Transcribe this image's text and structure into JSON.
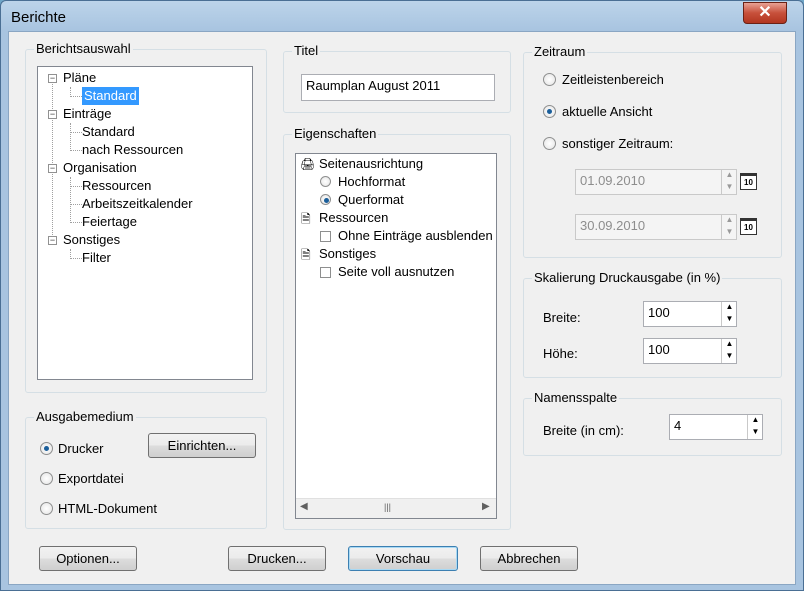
{
  "window": {
    "title": "Berichte",
    "close": "✕"
  },
  "berichtsauswahl": {
    "label": "Berichtsauswahl",
    "tree": {
      "plaene": "Pläne",
      "plaene_standard": "Standard",
      "eintraege": "Einträge",
      "eintraege_standard": "Standard",
      "eintraege_nach_ressourcen": "nach Ressourcen",
      "organisation": "Organisation",
      "org_ressourcen": "Ressourcen",
      "org_arbeitszeitkalender": "Arbeitszeitkalender",
      "org_feiertage": "Feiertage",
      "sonstiges": "Sonstiges",
      "sonst_filter": "Filter"
    }
  },
  "ausgabemedium": {
    "label": "Ausgabemedium",
    "drucker": "Drucker",
    "exportdatei": "Exportdatei",
    "html": "HTML-Dokument",
    "einrichten": "Einrichten..."
  },
  "titel": {
    "label": "Titel",
    "value": "Raumplan August 2011"
  },
  "eigenschaften": {
    "label": "Eigenschaften",
    "seitenausrichtung": "Seitenausrichtung",
    "hochformat": "Hochformat",
    "querformat": "Querformat",
    "ressourcen": "Ressourcen",
    "ohne_eintraege": "Ohne Einträge ausblenden",
    "sonstiges": "Sonstiges",
    "seite_voll": "Seite voll ausnutzen",
    "scroll_grip": "|||"
  },
  "zeitraum": {
    "label": "Zeitraum",
    "zeitleistenbereich": "Zeitleistenbereich",
    "aktuelle_ansicht": "aktuelle Ansicht",
    "sonstiger": "sonstiger Zeitraum:",
    "from": "01.09.2010",
    "to": "30.09.2010",
    "cal_icon_text": "10"
  },
  "skalierung": {
    "label": "Skalierung Druckausgabe (in %)",
    "breite_label": "Breite:",
    "breite": "100",
    "hoehe_label": "Höhe:",
    "hoehe": "100"
  },
  "namensspalte": {
    "label": "Namensspalte",
    "breite_label": "Breite (in cm):",
    "breite": "4"
  },
  "buttons": {
    "optionen": "Optionen...",
    "drucken": "Drucken...",
    "vorschau": "Vorschau",
    "abbrechen": "Abbrechen"
  }
}
